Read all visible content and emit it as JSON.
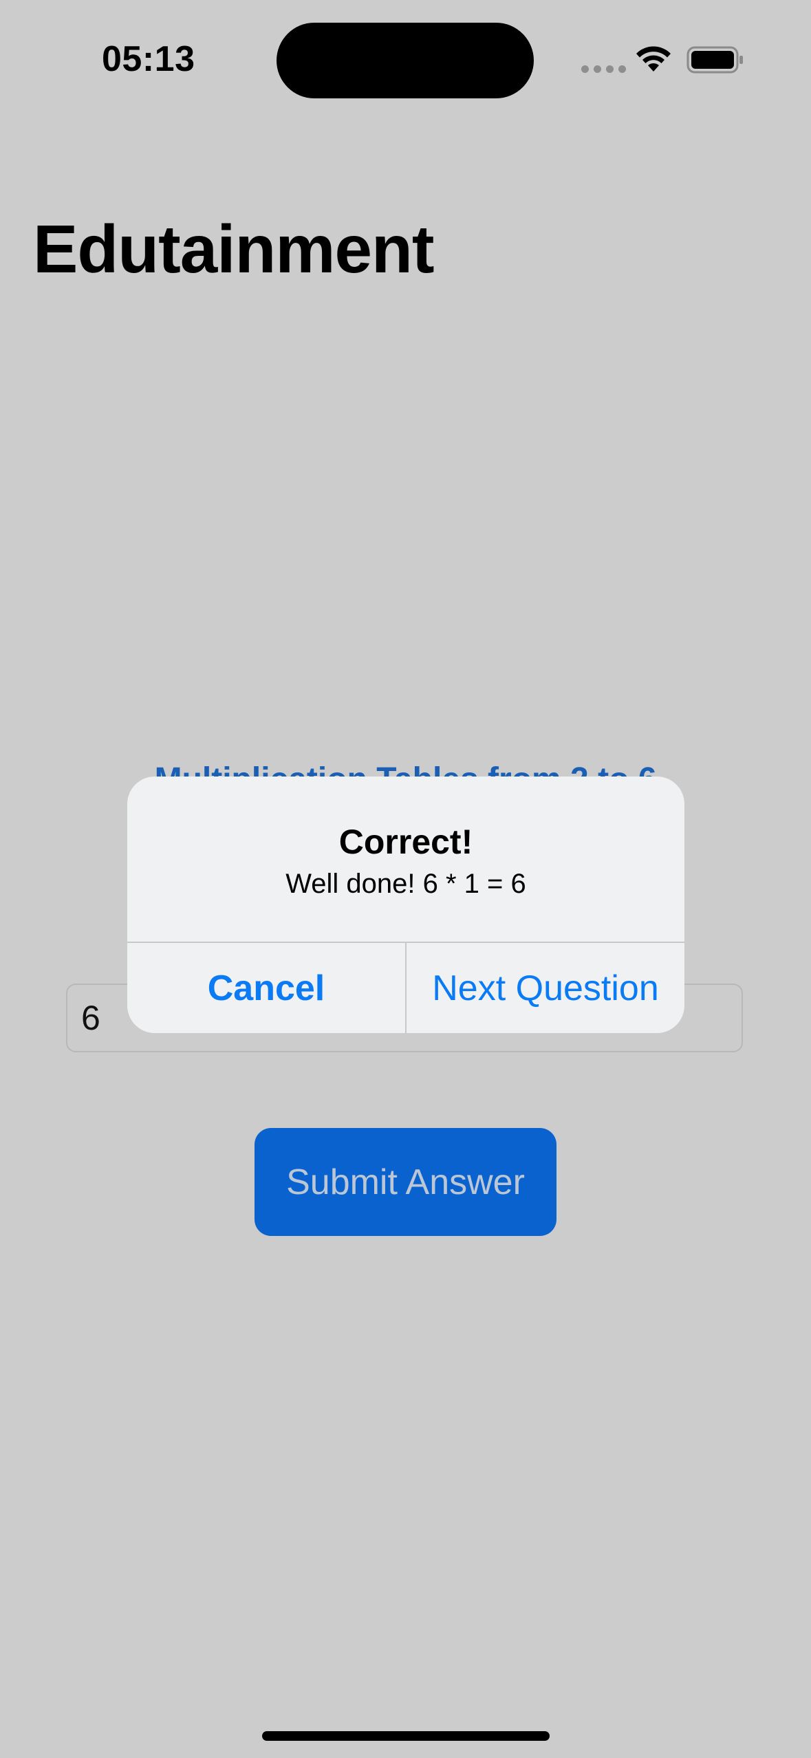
{
  "status_bar": {
    "time": "05:13"
  },
  "page": {
    "title": "Edutainment",
    "subtitle": "Multiplication Tables from 2 to 6"
  },
  "answer_field": {
    "value": "6"
  },
  "submit_button": {
    "label": "Submit Answer"
  },
  "alert": {
    "title": "Correct!",
    "message": "Well done! 6 * 1 = 6",
    "cancel_label": "Cancel",
    "next_label": "Next Question"
  },
  "colors": {
    "background": "#cccccc",
    "accent": "#0a7af5",
    "submit_bg": "#0a62cf",
    "alert_bg": "#eff1f2"
  },
  "icons": {
    "wifi": "wifi-icon",
    "battery": "battery-icon",
    "signal": "signal-dots-icon"
  }
}
